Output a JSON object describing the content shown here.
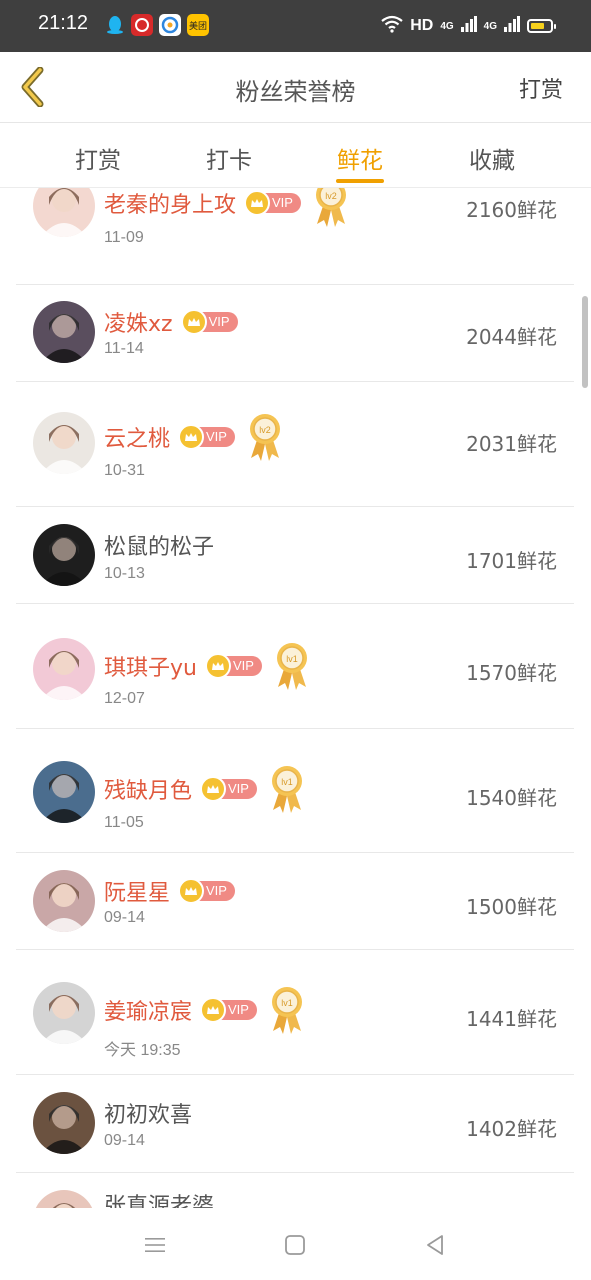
{
  "status_bar": {
    "time": "21:12",
    "apps": [
      "qq-icon",
      "app-red-icon",
      "browser-icon",
      "meituan-icon"
    ],
    "meituan_label": "美团",
    "hd_label": "HD",
    "network1": "4G",
    "network2": "4G",
    "battery_level": 0.7
  },
  "header": {
    "title": "粉丝荣誉榜",
    "action_label": "打赏"
  },
  "tabs": [
    {
      "label": "打赏",
      "active": false
    },
    {
      "label": "打卡",
      "active": false
    },
    {
      "label": "鲜花",
      "active": true
    },
    {
      "label": "收藏",
      "active": false
    }
  ],
  "list": [
    {
      "name": "老秦的身上攻",
      "vip": true,
      "vip_label": "VIP",
      "medal": "lv2",
      "date": "11-09",
      "count": "2160鲜花",
      "avatar_color": "#f3d8d0"
    },
    {
      "name": "凌姝xz",
      "vip": true,
      "vip_label": "VIP",
      "medal": "",
      "date": "11-14",
      "count": "2044鲜花",
      "avatar_color": "#5a4e5e"
    },
    {
      "name": "云之桃",
      "vip": true,
      "vip_label": "VIP",
      "medal": "lv2",
      "date": "10-31",
      "count": "2031鲜花",
      "avatar_color": "#ebe7e2"
    },
    {
      "name": "松鼠的松子",
      "vip": false,
      "vip_label": "",
      "medal": "",
      "date": "10-13",
      "count": "1701鲜花",
      "avatar_color": "#1e1e1e"
    },
    {
      "name": "琪琪子yu",
      "vip": true,
      "vip_label": "VIP",
      "medal": "lv1",
      "date": "12-07",
      "count": "1570鲜花",
      "avatar_color": "#f2c9d6"
    },
    {
      "name": "残缺月色",
      "vip": true,
      "vip_label": "VIP",
      "medal": "lv1",
      "date": "11-05",
      "count": "1540鲜花",
      "avatar_color": "#4b6d8e"
    },
    {
      "name": "阮星星",
      "vip": true,
      "vip_label": "VIP",
      "medal": "",
      "date": "09-14",
      "count": "1500鲜花",
      "avatar_color": "#c9a7a7"
    },
    {
      "name": "姜瑜凉宸",
      "vip": true,
      "vip_label": "VIP",
      "medal": "lv1",
      "date": "今天 19:35",
      "count": "1441鲜花",
      "avatar_color": "#d4d4d4"
    },
    {
      "name": "初初欢喜",
      "vip": false,
      "vip_label": "",
      "medal": "",
      "date": "09-14",
      "count": "1402鲜花",
      "avatar_color": "#6b5240"
    },
    {
      "name": "张真源老婆",
      "vip": false,
      "vip_label": "",
      "medal": "",
      "date": "",
      "count": "",
      "avatar_color": "#e8c6bb"
    }
  ],
  "colors": {
    "accent": "#f0a000",
    "vip_name": "#e05a3e",
    "vip_badge": "#f08a84",
    "status_bar": "#3f3f3f"
  },
  "nav": [
    "menu-icon",
    "home-square-icon",
    "back-triangle-icon"
  ]
}
